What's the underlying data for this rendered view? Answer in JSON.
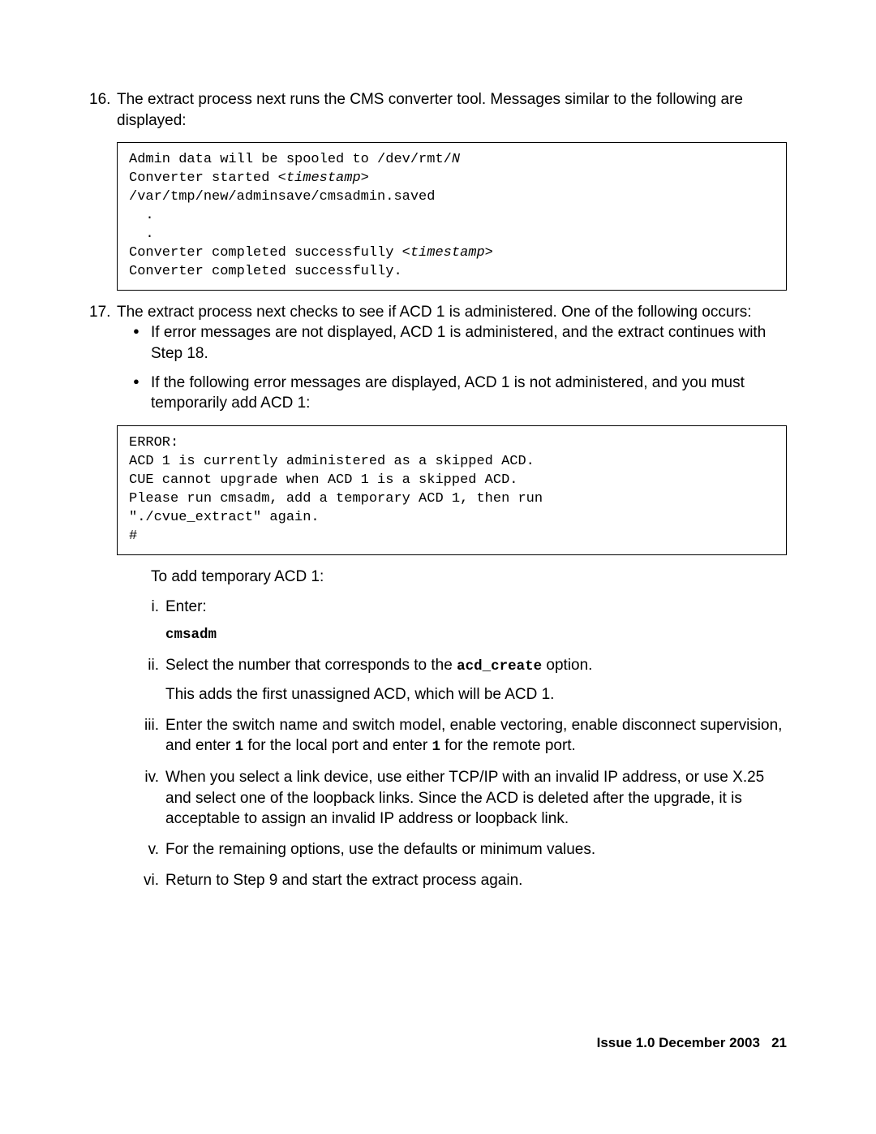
{
  "step16": {
    "number": "16.",
    "text": "The extract process next runs the CMS converter tool. Messages similar to the following are displayed:",
    "code_line1_a": "Admin data will be spooled to /dev/rmt/",
    "code_line1_b": "N",
    "code_line2_a": "Converter started ",
    "code_line2_b": "<timestamp>",
    "code_line3": "/var/tmp/new/adminsave/cmsadmin.saved",
    "code_line4": "  .",
    "code_line5": "  .",
    "code_line6_a": "Converter completed successfully ",
    "code_line6_b": "<timestamp>",
    "code_line7": "Converter completed successfully."
  },
  "step17": {
    "number": "17.",
    "text": "The extract process next checks to see if ACD 1 is administered. One of the following occurs:",
    "bullet1": "If error messages are not displayed, ACD 1 is administered, and the extract continues with Step 18.",
    "bullet2": "If the following error messages are displayed, ACD 1 is not administered, and you must temporarily add ACD 1:",
    "code_line1": "ERROR:",
    "code_line2": "ACD 1 is currently administered as a skipped ACD.",
    "code_line3": "CUE cannot upgrade when ACD 1 is a skipped ACD.",
    "code_line4": "Please run cmsadm, add a temporary ACD 1, then run",
    "code_line5": "\"./cvue_extract\" again.",
    "code_line6": "#",
    "add_acd_intro": "To add temporary ACD 1:",
    "roman": {
      "i_num": "i.",
      "i_text": "Enter:",
      "i_cmd": "cmsadm",
      "ii_num": "ii.",
      "ii_text_a": "Select the number that corresponds to the ",
      "ii_text_b": "acd_create",
      "ii_text_c": " option.",
      "ii_text2": "This adds the first unassigned ACD, which will be ACD 1.",
      "iii_num": "iii.",
      "iii_text_a": "Enter the switch name and switch model, enable vectoring, enable disconnect supervision, and enter ",
      "iii_text_b": "1",
      "iii_text_c": " for the local port and enter ",
      "iii_text_d": "1",
      "iii_text_e": " for the remote port.",
      "iv_num": "iv.",
      "iv_text": "When you select a link device, use either TCP/IP with an invalid IP address, or use X.25 and select one of the loopback links. Since the ACD is deleted after the upgrade, it is acceptable to assign an invalid IP address or loopback link.",
      "v_num": "v.",
      "v_text": "For the remaining options, use the defaults or minimum values.",
      "vi_num": "vi.",
      "vi_text": "Return to Step 9 and start the extract process again."
    }
  },
  "footer": {
    "issue": "Issue 1.0   December 2003",
    "page": "21"
  }
}
